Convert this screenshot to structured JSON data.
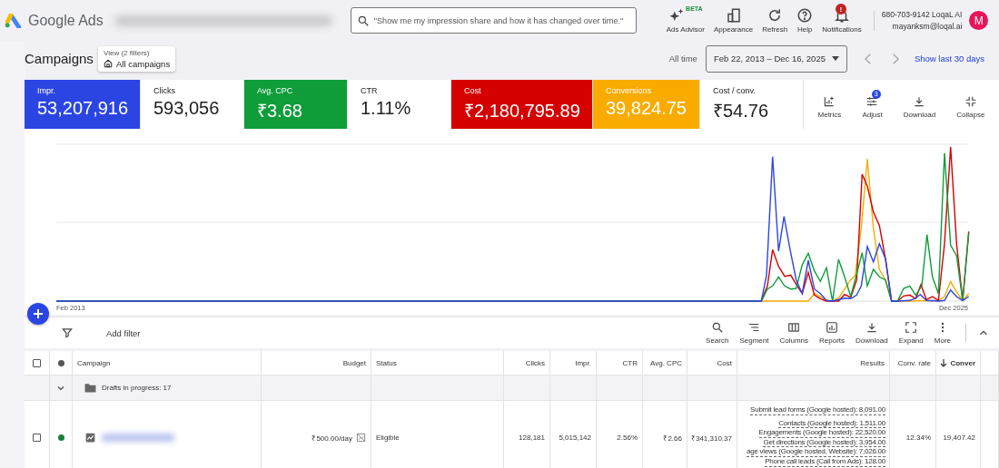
{
  "header": {
    "product": "Google Ads",
    "search": {
      "placeholder": "\"Show me my impression share and how it has changed over time.\""
    },
    "actions": [
      {
        "label": "Ads Advisor",
        "badge": "BETA"
      },
      {
        "label": "Appearance"
      },
      {
        "label": "Refresh"
      },
      {
        "label": "Help"
      },
      {
        "label": "Notifications",
        "badge": "!"
      }
    ],
    "account": {
      "name": "680-703-9142 LoqaL AI",
      "email": "mayanksm@loqal.ai",
      "avatar": "M"
    }
  },
  "page": {
    "title": "Campaigns",
    "view": {
      "caption": "View (2 filters)",
      "value": "All campaigns"
    },
    "range_label": "All time",
    "date_range": "Feb 22, 2013 – Dec 16, 2025",
    "link": "Show last 30 days"
  },
  "metrics": [
    {
      "label": "Impr.",
      "value": "53,207,916",
      "selected": true,
      "color": "#2b45e3"
    },
    {
      "label": "Clicks",
      "value": "593,056",
      "selected": false
    },
    {
      "label": "Avg. CPC",
      "value": "₹3.68",
      "selected": true,
      "color": "#0f9d3a"
    },
    {
      "label": "CTR",
      "value": "1.11%",
      "selected": false
    },
    {
      "label": "Cost",
      "value": "₹2,180,795.89",
      "selected": true,
      "color": "#d50000"
    },
    {
      "label": "Conversions",
      "value": "39,824.75",
      "selected": true,
      "color": "#f9ab00"
    },
    {
      "label": "Cost / conv.",
      "value": "₹54.76",
      "selected": false
    }
  ],
  "metric_tools": [
    {
      "label": "Metrics"
    },
    {
      "label": "Adjust",
      "badge": "3"
    },
    {
      "label": "Download"
    },
    {
      "label": "Collapse"
    }
  ],
  "chart": {
    "x_labels": [
      "Feb 2013",
      "Dec 2025"
    ]
  },
  "toolbar": {
    "filter": "Add filter",
    "tools": [
      {
        "label": "Search"
      },
      {
        "label": "Segment"
      },
      {
        "label": "Columns"
      },
      {
        "label": "Reports"
      },
      {
        "label": "Download"
      },
      {
        "label": "Expand"
      },
      {
        "label": "More"
      }
    ]
  },
  "table": {
    "columns": [
      {
        "label": "Campaign",
        "sorted": false
      },
      {
        "label": "Budget",
        "sorted": false
      },
      {
        "label": "Status",
        "sorted": false
      },
      {
        "label": "Clicks",
        "sorted": false
      },
      {
        "label": "Impr.",
        "sorted": false
      },
      {
        "label": "CTR",
        "sorted": false
      },
      {
        "label": "Avg. CPC",
        "sorted": false
      },
      {
        "label": "Cost",
        "sorted": false
      },
      {
        "label": "Results",
        "sorted": false
      },
      {
        "label": "Conv. rate",
        "sorted": false
      },
      {
        "label": "Conver",
        "sorted": true
      }
    ],
    "all_checked": false,
    "group": {
      "label": "Drafts in progress: 17",
      "expanded": false
    },
    "rows": [
      {
        "checked": false,
        "color": "#188038",
        "budget": "₹500.00/day",
        "status": "Eligible",
        "clicks": "128,181",
        "impr": "5,015,142",
        "ctr": "2.56%",
        "avg_cpc": "₹2.66",
        "cost": "₹341,310.37",
        "results": [
          "Submit lead forms (Google hosted): 8,091.00",
          "Contacts (Google hosted): 1,511.00",
          "Engagements (Google hosted): 22,520.00",
          "Get directions (Google hosted): 3,954.00",
          "age views (Google hosted, Website): 7,026.00",
          "Phone call leads (Call from Ads): 128.00"
        ],
        "conv_rate": "12.34%",
        "conversions": "19,407.42"
      }
    ]
  }
}
